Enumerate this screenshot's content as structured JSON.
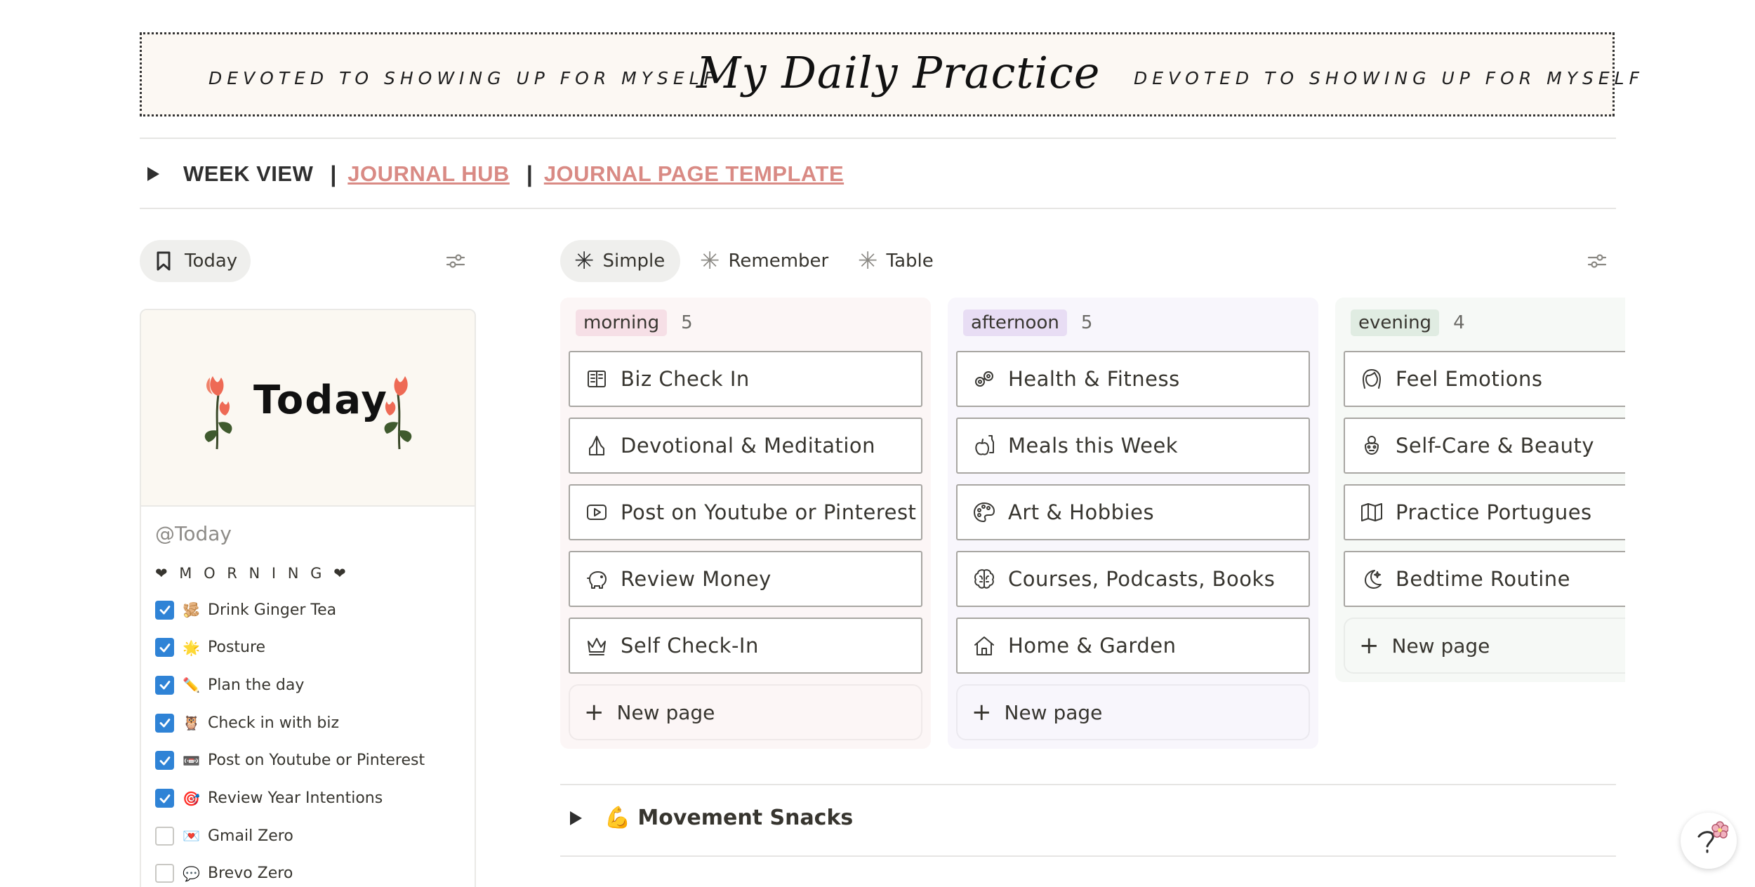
{
  "banner": {
    "left_tagline": "DEVOTED TO SHOWING UP FOR MYSELF",
    "title": "My Daily Practice",
    "right_tagline": "DEVOTED TO SHOWING UP FOR MYSELF"
  },
  "nav": {
    "week_view": "WEEK VIEW",
    "separator": "|",
    "journal_hub": "JOURNAL HUB",
    "journal_template": "JOURNAL PAGE TEMPLATE"
  },
  "left_view": {
    "tab_label": "Today",
    "cover_text": "Today",
    "mention": "@Today",
    "section_title": "❤ M O R N I N G ❤",
    "todos": [
      {
        "emoji": "🫚",
        "label": "Drink Ginger Tea",
        "checked": true
      },
      {
        "emoji": "🌟",
        "label": "Posture",
        "checked": true
      },
      {
        "emoji": "✏️",
        "label": "Plan the day",
        "checked": true
      },
      {
        "emoji": "🦉",
        "label": "Check in with biz",
        "checked": true
      },
      {
        "emoji": "📼",
        "label": "Post on Youtube or Pinterest",
        "checked": true
      },
      {
        "emoji": "🎯",
        "label": "Review Year Intentions",
        "checked": true
      },
      {
        "emoji": "💌",
        "label": "Gmail Zero",
        "checked": false
      },
      {
        "emoji": "💬",
        "label": "Brevo Zero",
        "checked": false
      }
    ]
  },
  "board": {
    "tabs": [
      {
        "label": "Simple",
        "active": true
      },
      {
        "label": "Remember",
        "active": false
      },
      {
        "label": "Table",
        "active": false
      }
    ],
    "new_page_label": "New page",
    "columns": [
      {
        "name": "morning",
        "count": "5",
        "chip_color": "#f6dfe6",
        "bg_color": "#fcf6f6",
        "cards": [
          {
            "icon": "book-icon",
            "label": "Biz Check In"
          },
          {
            "icon": "praying-hands-icon",
            "label": "Devotional & Meditation"
          },
          {
            "icon": "play-video-icon",
            "label": "Post on Youtube or Pinterest"
          },
          {
            "icon": "piggy-bank-icon",
            "label": "Review Money"
          },
          {
            "icon": "crown-icon",
            "label": "Self Check-In"
          }
        ]
      },
      {
        "name": "afternoon",
        "count": "5",
        "chip_color": "#e8ddf4",
        "bg_color": "#f8f6fc",
        "cards": [
          {
            "icon": "weights-icon",
            "label": "Health & Fitness"
          },
          {
            "icon": "apple-bottle-icon",
            "label": "Meals this Week"
          },
          {
            "icon": "palette-icon",
            "label": "Art & Hobbies"
          },
          {
            "icon": "brain-icon",
            "label": "Courses, Podcasts, Books"
          },
          {
            "icon": "house-icon",
            "label": "Home & Garden"
          }
        ]
      },
      {
        "name": "evening",
        "count": "4",
        "chip_color": "#e0ece2",
        "bg_color": "#f6f9f6",
        "cards": [
          {
            "icon": "woman-face-icon",
            "label": "Feel Emotions"
          },
          {
            "icon": "face-mask-icon",
            "label": "Self-Care & Beauty"
          },
          {
            "icon": "map-icon",
            "label": "Practice Portugues"
          },
          {
            "icon": "moon-stars-icon",
            "label": "Bedtime Routine"
          }
        ]
      }
    ]
  },
  "movement": {
    "emoji": "💪",
    "label": "Movement Snacks"
  },
  "help": {
    "icon": "help-flower-icon"
  }
}
